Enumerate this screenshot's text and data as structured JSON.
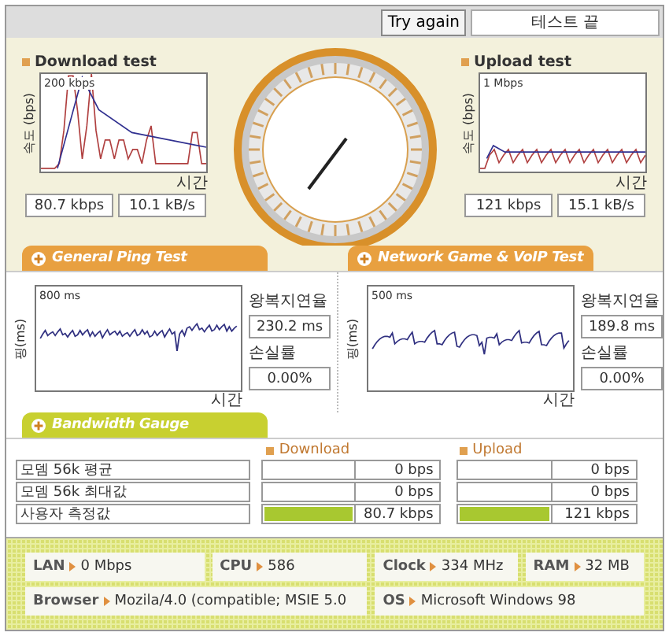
{
  "top_bar": {
    "try_again": "Try again",
    "status": "테스트 끝"
  },
  "speed_tests": [
    {
      "title": "Download test",
      "y_axis": "속도 (bps)",
      "max_label": "200 kbps",
      "x_axis": "시간",
      "rate": "80.7 kbps",
      "throughput": "10.1 kB/s"
    },
    {
      "title": "Upload test",
      "y_axis": "속도 (bps)",
      "max_label": "1 Mbps",
      "x_axis": "시간",
      "rate": "121 kbps",
      "throughput": "15.1 kB/s"
    }
  ],
  "ping_tests": [
    {
      "tab": "General Ping Test",
      "y_axis": "핑(ms)",
      "max_label": "800 ms",
      "x_axis": "시간",
      "latency_label": "왕복지연율",
      "latency": "230.2 ms",
      "loss_label": "손실률",
      "loss": "0.00%"
    },
    {
      "tab": "Network Game & VoIP Test",
      "y_axis": "핑(ms)",
      "max_label": "500 ms",
      "x_axis": "시간",
      "latency_label": "왕복지연율",
      "latency": "189.8 ms",
      "loss_label": "손실률",
      "loss": "0.00%"
    }
  ],
  "bandwidth": {
    "tab": "Bandwidth Gauge",
    "headers": [
      "Download",
      "Upload"
    ],
    "rows": [
      {
        "label": "모뎀 56k 평균",
        "download": {
          "value": "0 bps"
        },
        "upload": {
          "value": "0 bps"
        }
      },
      {
        "label": "모뎀 56k 최대값",
        "download": {
          "value": "0 bps"
        },
        "upload": {
          "value": "0 bps"
        }
      },
      {
        "label": "사용자 측정값",
        "download": {
          "level": 1,
          "value": "80.7 kbps"
        },
        "upload": {
          "level": 1,
          "value": "121 kbps"
        }
      }
    ]
  },
  "system_info": [
    {
      "label": "LAN",
      "value": "0 Mbps"
    },
    {
      "label": "CPU",
      "value": "586"
    },
    {
      "label": "Clock",
      "value": "334 MHz"
    },
    {
      "label": "RAM",
      "value": "32 MB"
    },
    {
      "label": "Browser",
      "value": "Mozila/4.0 (compatible; MSIE 5.0"
    },
    {
      "label": "OS",
      "value": "Microsoft Windows 98"
    }
  ]
}
